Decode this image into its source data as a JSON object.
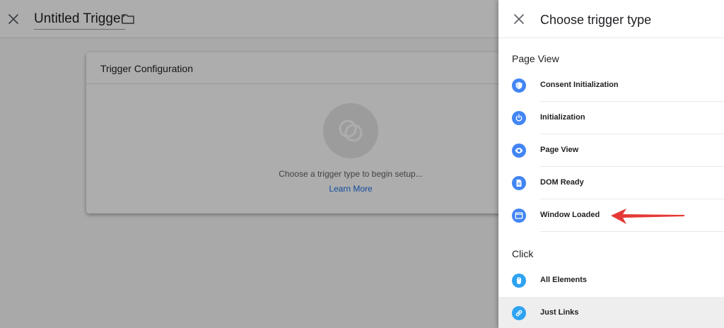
{
  "editor": {
    "title": "Untitled Trigger",
    "card": {
      "heading": "Trigger Configuration",
      "empty_message": "Choose a trigger type to begin setup...",
      "learn_more": "Learn More"
    }
  },
  "panel": {
    "title": "Choose trigger type",
    "sections": [
      {
        "label": "Page View",
        "items": [
          {
            "label": "Consent Initialization",
            "icon": "shield-icon",
            "color": "#4285f4"
          },
          {
            "label": "Initialization",
            "icon": "power-icon",
            "color": "#4285f4"
          },
          {
            "label": "Page View",
            "icon": "eye-icon",
            "color": "#4285f4"
          },
          {
            "label": "DOM Ready",
            "icon": "document-icon",
            "color": "#4285f4"
          },
          {
            "label": "Window Loaded",
            "icon": "window-icon",
            "color": "#4285f4"
          }
        ]
      },
      {
        "label": "Click",
        "items": [
          {
            "label": "All Elements",
            "icon": "mouse-icon",
            "color": "#2ea3f2"
          },
          {
            "label": "Just Links",
            "icon": "link-icon",
            "color": "#2ea3f2"
          }
        ]
      }
    ]
  },
  "colors": {
    "accent_blue": "#1a73e8",
    "annotation_red": "#e53935"
  }
}
